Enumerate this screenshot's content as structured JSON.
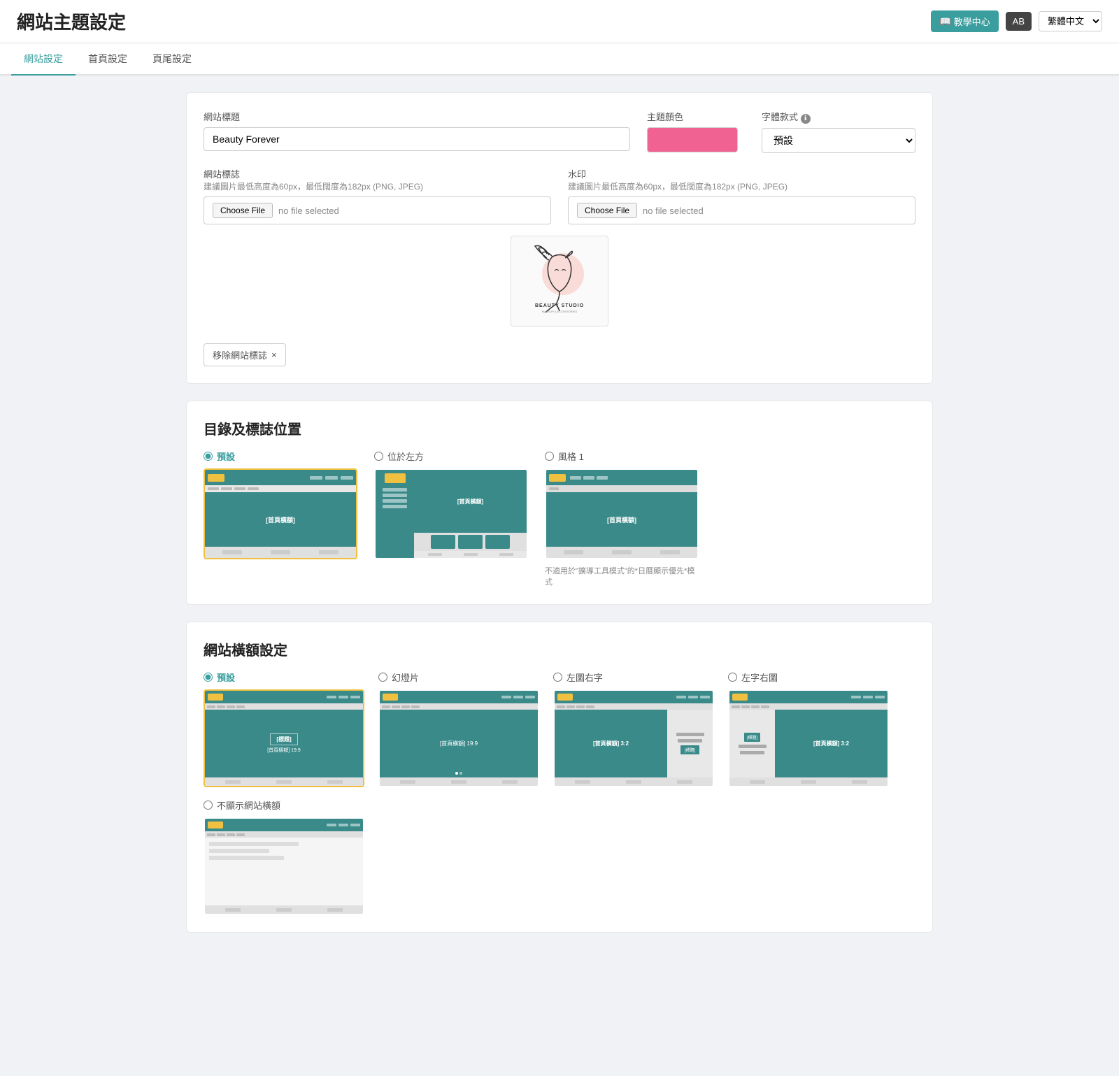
{
  "header": {
    "title": "網站主題設定",
    "tutorial_btn": "教學中心",
    "ab_btn": "AB",
    "lang_select": "繁體中文"
  },
  "tabs": [
    {
      "label": "網站設定",
      "active": true
    },
    {
      "label": "首頁設定",
      "active": false
    },
    {
      "label": "頁尾設定",
      "active": false
    }
  ],
  "site_settings": {
    "title_label": "網站標題",
    "title_value": "Beauty Forever",
    "theme_color_label": "主題顏色",
    "font_label": "字體款式",
    "font_info": "ℹ",
    "font_value": "預設",
    "font_options": [
      "預設"
    ],
    "logo_label": "網站標誌",
    "logo_hint": "建議圖片最低高度為60px，最低闊度為182px (PNG, JPEG)",
    "logo_choose": "Choose File",
    "logo_no_file": "no file selected",
    "watermark_label": "水印",
    "watermark_hint": "建議圖片最低高度為60px，最低闊度為182px (PNG, JPEG)",
    "watermark_choose": "Choose File",
    "watermark_no_file": "no file selected",
    "remove_logo_btn": "移除網站標誌",
    "remove_x": "×"
  },
  "nav_position": {
    "title": "目錄及標誌位置",
    "options": [
      {
        "label": "預設",
        "value": "default",
        "selected": true
      },
      {
        "label": "位於左方",
        "value": "left",
        "selected": false
      },
      {
        "label": "風格 1",
        "value": "style1",
        "selected": false
      }
    ],
    "note": "不適用於\"擴導工具模式\"的*日暦顯示優先*模式"
  },
  "banner_settings": {
    "title": "網站橫額設定",
    "options": [
      {
        "label": "預設",
        "value": "default",
        "selected": true
      },
      {
        "label": "幻燈片",
        "value": "slideshow",
        "selected": false
      },
      {
        "label": "左圖右字",
        "value": "left_img_right_text",
        "selected": false
      },
      {
        "label": "左字右圖",
        "value": "left_text_right_img",
        "selected": false
      },
      {
        "label": "不顯示網站橫額",
        "value": "none",
        "selected": false
      }
    ],
    "banner_title_text": "[標題]",
    "banner_sub_text": "[首頁橫額] 19:9",
    "slideshow_text": "[首頁橫額] 19:9",
    "left_img_text": "[首頁橫額] 3:2",
    "left_title_text": "[標題]",
    "right_img_text": "[首頁橫額] 3:2",
    "right_title_text": "[標題]"
  }
}
